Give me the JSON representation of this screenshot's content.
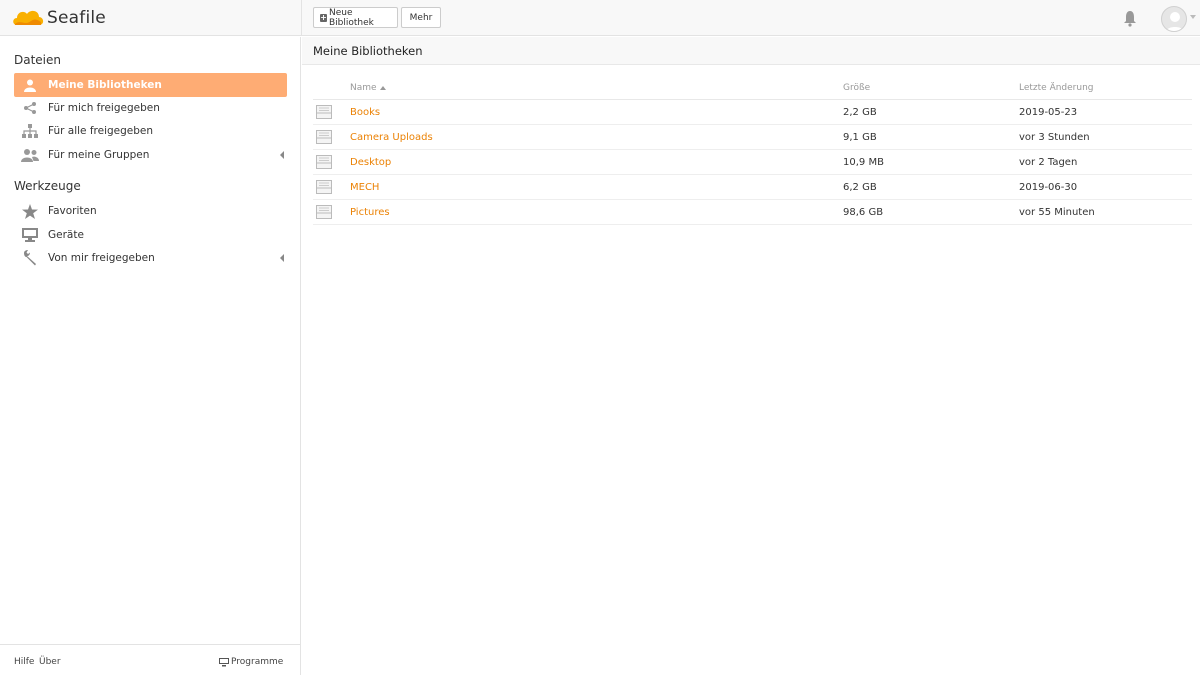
{
  "app": {
    "name": "Seafile"
  },
  "toolbar": {
    "new_library_label": "Neue Bibliothek",
    "more_label": "Mehr"
  },
  "sidebar": {
    "files_title": "Dateien",
    "files_items": [
      {
        "label": "Meine Bibliotheken",
        "icon": "user-icon",
        "active": true
      },
      {
        "label": "Für mich freigegeben",
        "icon": "share-icon"
      },
      {
        "label": "Für alle freigegeben",
        "icon": "org-chart-icon"
      },
      {
        "label": "Für meine Gruppen",
        "icon": "group-icon"
      }
    ],
    "tools_title": "Werkzeuge",
    "tools_items": [
      {
        "label": "Favoriten",
        "icon": "star-icon"
      },
      {
        "label": "Geräte",
        "icon": "monitor-icon"
      },
      {
        "label": "Von mir freigegeben",
        "icon": "wrench-icon"
      }
    ],
    "footer": {
      "help": "Hilfe",
      "about": "Über",
      "programs": "Programme"
    }
  },
  "main": {
    "title": "Meine Bibliotheken",
    "columns": {
      "name": "Name",
      "size": "Größe",
      "modified": "Letzte Änderung"
    },
    "rows": [
      {
        "name": "Books",
        "size": "2,2 GB",
        "modified": "2019-05-23"
      },
      {
        "name": "Camera Uploads",
        "size": "9,1 GB",
        "modified": "vor 3 Stunden"
      },
      {
        "name": "Desktop",
        "size": "10,9 MB",
        "modified": "vor 2 Tagen"
      },
      {
        "name": "MECH",
        "size": "6,2 GB",
        "modified": "2019-06-30"
      },
      {
        "name": "Pictures",
        "size": "98,6 GB",
        "modified": "vor 55 Minuten"
      }
    ]
  },
  "colors": {
    "accent": "#feac74",
    "link": "#eb8205",
    "brand_yellow": "#f9b000"
  }
}
